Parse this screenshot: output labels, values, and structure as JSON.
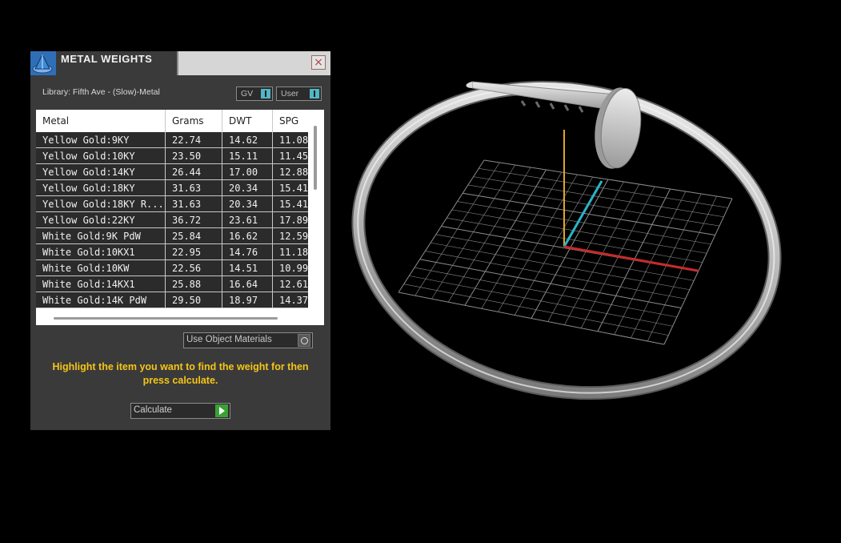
{
  "panel": {
    "title": "METAL WEIGHTS",
    "close_label": "×",
    "library_label": "Library: Fifth Ave - (Slow)-Metal",
    "toggle_gv": "GV",
    "toggle_user": "User",
    "use_object_materials_label": "Use Object Materials",
    "hint": "Highlight the item you want to find the weight for then press calculate.",
    "calculate_label": "Calculate",
    "accent_color": "#f5c518",
    "toggle_color": "#4fb7c6",
    "calc_color": "#3aa135"
  },
  "table": {
    "headers": [
      "Metal",
      "Grams",
      "DWT",
      "SPG"
    ],
    "rows": [
      [
        "Yellow Gold:9KY",
        "22.74",
        "14.62",
        "11.08"
      ],
      [
        "Yellow Gold:10KY",
        "23.50",
        "15.11",
        "11.45"
      ],
      [
        "Yellow Gold:14KY",
        "26.44",
        "17.00",
        "12.88"
      ],
      [
        "Yellow Gold:18KY",
        "31.63",
        "20.34",
        "15.41"
      ],
      [
        "Yellow Gold:18KY R...",
        "31.63",
        "20.34",
        "15.41"
      ],
      [
        "Yellow Gold:22KY",
        "36.72",
        "23.61",
        "17.89"
      ],
      [
        "White Gold:9K PdW",
        "25.84",
        "16.62",
        "12.59"
      ],
      [
        "White Gold:10KX1",
        "22.95",
        "14.76",
        "11.18"
      ],
      [
        "White Gold:10KW",
        "22.56",
        "14.51",
        "10.99"
      ],
      [
        "White Gold:14KX1",
        "25.88",
        "16.64",
        "12.61"
      ],
      [
        "White Gold:14K PdW",
        "29.50",
        "18.97",
        "14.37"
      ]
    ]
  },
  "viewport": {
    "object": "nail-bracelet",
    "axis_colors": {
      "x": "#c62a2a",
      "y": "#e0a52e",
      "z": "#2ab4c6"
    },
    "grid_color": "#8c8c8c",
    "background": "#000000"
  }
}
